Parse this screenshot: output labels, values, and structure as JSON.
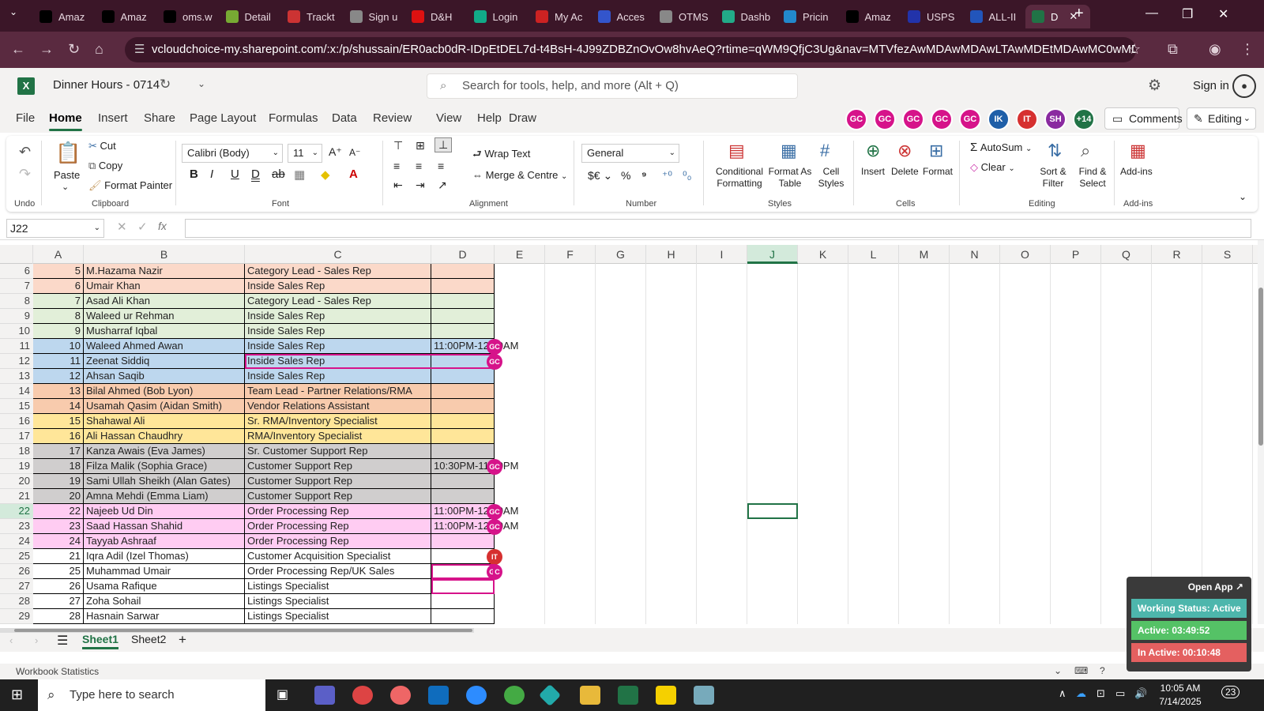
{
  "browser": {
    "tabs": [
      {
        "label": "Amaz",
        "icon": "amazon-icon",
        "color": "#000"
      },
      {
        "label": "Amaz",
        "icon": "amazon-icon",
        "color": "#000"
      },
      {
        "label": "oms.w",
        "icon": "oms-icon",
        "color": "#000"
      },
      {
        "label": "Detail",
        "icon": "detail-icon",
        "color": "#7a3"
      },
      {
        "label": "Trackt",
        "icon": "tracking-icon",
        "color": "#c33"
      },
      {
        "label": "Sign u",
        "icon": "globe-icon",
        "color": "#888"
      },
      {
        "label": "D&H",
        "icon": "dh-icon",
        "color": "#d11"
      },
      {
        "label": "Login",
        "icon": "login-icon",
        "color": "#1a8"
      },
      {
        "label": "My Ac",
        "icon": "myaccount-icon",
        "color": "#c22"
      },
      {
        "label": "Acces",
        "icon": "access-icon",
        "color": "#35c"
      },
      {
        "label": "OTMS",
        "icon": "otms-icon",
        "color": "#888"
      },
      {
        "label": "Dashb",
        "icon": "dashboard-icon",
        "color": "#2a8"
      },
      {
        "label": "Pricin",
        "icon": "pricing-icon",
        "color": "#28c"
      },
      {
        "label": "Amaz",
        "icon": "amazon-icon",
        "color": "#000"
      },
      {
        "label": "USPS",
        "icon": "usps-icon",
        "color": "#23a"
      },
      {
        "label": "ALL-II",
        "icon": "all-icon",
        "color": "#25b"
      },
      {
        "label": "D",
        "icon": "excel-icon",
        "color": "#217346",
        "active": true
      }
    ],
    "url": "vcloudchoice-my.sharepoint.com/:x:/p/shussain/ER0acb0dR-IDpEtDEL7d-t4BsH-4J99ZDBZnOvOw8hvAeQ?rtime=qWM9QfjC3Ug&nav=MTVfezAwMDAwMDAwLTAwMDEtMDAwMC0wMDAwLTAwM..."
  },
  "excel": {
    "title": "Dinner Hours - 0714",
    "search_placeholder": "Search for tools, help, and more (Alt + Q)",
    "sign_in": "Sign in",
    "menus": [
      "File",
      "Home",
      "Insert",
      "Share",
      "Page Layout",
      "Formulas",
      "Data",
      "Review",
      "View",
      "Help",
      "Draw"
    ],
    "active_menu": "Home",
    "avatars": [
      {
        "text": "GC",
        "color": "#d6138a"
      },
      {
        "text": "GC",
        "color": "#d6138a"
      },
      {
        "text": "GC",
        "color": "#d6138a"
      },
      {
        "text": "GC",
        "color": "#d6138a"
      },
      {
        "text": "GC",
        "color": "#d6138a"
      },
      {
        "text": "IK",
        "color": "#1f5fa8"
      },
      {
        "text": "IT",
        "color": "#d63030"
      },
      {
        "text": "SH",
        "color": "#8a2aa0"
      },
      {
        "text": "+14",
        "color": "#217346"
      }
    ],
    "comments": "Comments",
    "editing": "Editing",
    "ribbon": {
      "undo_group": "Undo",
      "paste": "Paste",
      "cut": "Cut",
      "copy": "Copy",
      "format_painter": "Format Painter",
      "clipboard_group": "Clipboard",
      "font_name": "Calibri (Body)",
      "font_size": "11",
      "font_group": "Font",
      "wrap_text": "Wrap Text",
      "merge_centre": "Merge & Centre",
      "alignment_group": "Alignment",
      "number_format": "General",
      "number_group": "Number",
      "conditional_formatting": "Conditional Formatting",
      "format_as_table": "Format As Table",
      "cell_styles": "Cell Styles",
      "styles_group": "Styles",
      "insert": "Insert",
      "delete": "Delete",
      "format": "Format",
      "cells_group": "Cells",
      "autosum": "AutoSum",
      "clear": "Clear",
      "sort_filter": "Sort & Filter",
      "find_select": "Find & Select",
      "editing_group": "Editing",
      "addins": "Add-ins",
      "addins_group": "Add-ins"
    },
    "name_box": "J22",
    "columns": [
      "A",
      "B",
      "C",
      "D",
      "E",
      "F",
      "G",
      "H",
      "I",
      "J",
      "K",
      "L",
      "M",
      "N",
      "O",
      "P",
      "Q",
      "R",
      "S"
    ],
    "selected_column": "J",
    "selected_row": "22",
    "rows": [
      {
        "row": "6",
        "a": "5",
        "b": "M.Hazama Nazir",
        "c": "Category Lead - Sales Rep",
        "d": "",
        "color": "#fbd9c9"
      },
      {
        "row": "7",
        "a": "6",
        "b": "Umair Khan",
        "c": "Inside Sales Rep",
        "d": "",
        "color": "#fbd9c9"
      },
      {
        "row": "8",
        "a": "7",
        "b": "Asad Ali Khan",
        "c": "Category Lead - Sales Rep",
        "d": "",
        "color": "#e2efd9"
      },
      {
        "row": "9",
        "a": "8",
        "b": "Waleed ur Rehman",
        "c": "Inside Sales Rep",
        "d": "",
        "color": "#e2efd9"
      },
      {
        "row": "10",
        "a": "9",
        "b": "Musharraf Iqbal",
        "c": "Inside Sales Rep",
        "d": "",
        "color": "#e2efd9"
      },
      {
        "row": "11",
        "a": "10",
        "b": "Waleed Ahmed Awan",
        "c": "Inside Sales Rep",
        "d": "11:00PM-12:00AM",
        "color": "#bdd7ee"
      },
      {
        "row": "12",
        "a": "11",
        "b": "Zeenat Siddiq",
        "c": "Inside Sales Rep",
        "d": "",
        "color": "#bdd7ee"
      },
      {
        "row": "13",
        "a": "12",
        "b": "Ahsan Saqib",
        "c": "Inside Sales Rep",
        "d": "",
        "color": "#bdd7ee"
      },
      {
        "row": "14",
        "a": "13",
        "b": "Bilal Ahmed (Bob Lyon)",
        "c": "Team Lead - Partner Relations/RMA",
        "d": "",
        "color": "#f8cbad"
      },
      {
        "row": "15",
        "a": "14",
        "b": "Usamah Qasim (Aidan Smith)",
        "c": "Vendor Relations Assistant",
        "d": "",
        "color": "#f8cbad"
      },
      {
        "row": "16",
        "a": "15",
        "b": "Shahawal Ali",
        "c": "Sr. RMA/Inventory Specialist",
        "d": "",
        "color": "#ffe699"
      },
      {
        "row": "17",
        "a": "16",
        "b": "Ali Hassan Chaudhry",
        "c": "RMA/Inventory Specialist",
        "d": "",
        "color": "#ffe699"
      },
      {
        "row": "18",
        "a": "17",
        "b": "Kanza Awais (Eva James)",
        "c": "Sr. Customer Support Rep",
        "d": "",
        "color": "#d0cece"
      },
      {
        "row": "19",
        "a": "18",
        "b": "Filza Malik (Sophia Grace)",
        "c": "Customer Support Rep",
        "d": "10:30PM-11:30PM",
        "color": "#d0cece"
      },
      {
        "row": "20",
        "a": "19",
        "b": "Sami Ullah Sheikh (Alan Gates)",
        "c": "Customer Support Rep",
        "d": "",
        "color": "#d0cece"
      },
      {
        "row": "21",
        "a": "20",
        "b": "Amna Mehdi (Emma Liam)",
        "c": "Customer Support Rep",
        "d": "",
        "color": "#d0cece"
      },
      {
        "row": "22",
        "a": "22",
        "b": "Najeeb Ud Din",
        "c": "Order Processing Rep",
        "d": "11:00PM-12:00AM",
        "color": "#ffccf2"
      },
      {
        "row": "23",
        "a": "23",
        "b": "Saad Hassan Shahid",
        "c": "Order Processing Rep",
        "d": "11:00PM-12:00AM",
        "color": "#ffccf2"
      },
      {
        "row": "24",
        "a": "24",
        "b": "Tayyab Ashraaf",
        "c": "Order Processing Rep",
        "d": "",
        "color": "#ffccf2"
      },
      {
        "row": "25",
        "a": "21",
        "b": "Iqra Adil (Izel Thomas)",
        "c": "Customer Acquisition Specialist",
        "d": "",
        "color": "#ffffff"
      },
      {
        "row": "26",
        "a": "25",
        "b": "Muhammad Umair",
        "c": "Order Processing Rep/UK Sales",
        "d": "",
        "color": "#ffffff"
      },
      {
        "row": "27",
        "a": "26",
        "b": "Usama Rafique",
        "c": "Listings Specialist",
        "d": "",
        "color": "#ffffff"
      },
      {
        "row": "28",
        "a": "27",
        "b": "Zoha Sohail",
        "c": "Listings Specialist",
        "d": "",
        "color": "#ffffff"
      },
      {
        "row": "29",
        "a": "28",
        "b": "Hasnain Sarwar",
        "c": "Listings Specialist",
        "d": "",
        "color": "#ffffff"
      }
    ],
    "sheets": [
      "Sheet1",
      "Sheet2"
    ],
    "active_sheet": "Sheet1",
    "status_left": "Workbook Statistics"
  },
  "tracker": {
    "open_app": "Open App ↗",
    "status": "Working Status: Active",
    "active": "Active: 03:49:52",
    "inactive": "In Active: 00:10:48"
  },
  "taskbar": {
    "search_placeholder": "Type here to search",
    "time": "10:05 AM",
    "date": "7/14/2025",
    "notifications": "23"
  }
}
